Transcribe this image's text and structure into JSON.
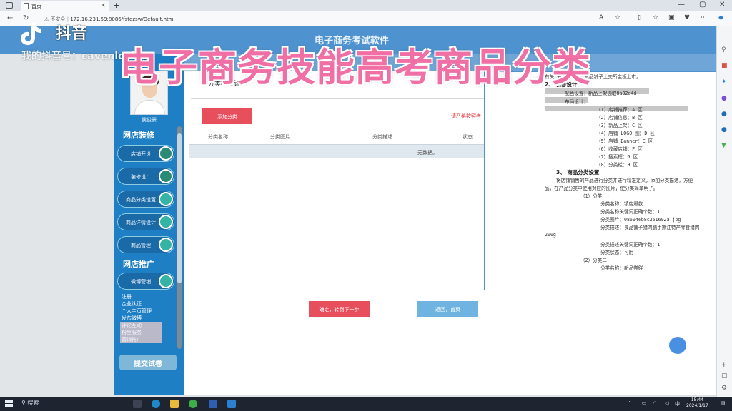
{
  "browser": {
    "tab_title": "首页",
    "tab_close": "✕",
    "new_tab": "+",
    "address_warning": "不安全",
    "url": "172.16.231.59:8086/fstdzsw/Default.html",
    "win_min": "—",
    "win_max": "▢",
    "win_close": "✕"
  },
  "page": {
    "app_title": "电子商务考试软件"
  },
  "sidebar": {
    "user_name": "侯俊豪",
    "section_shop_design": "网店装修",
    "menu": [
      "店铺开设",
      "装修设计",
      "商品分类设置",
      "商品详情设计",
      "商品管理"
    ],
    "section_promotion": "网店推广",
    "promo_item": "微博营销",
    "sub_items": [
      "注册",
      "企业认证",
      "个人主页管理",
      "发布微博",
      "评论互动",
      "粉丝服务",
      "营销推广"
    ],
    "submit_label": "提交试卷"
  },
  "content": {
    "title": "分类栏设计",
    "add_button": "添加分类",
    "note": "请严格按照考",
    "columns": [
      "分类名称",
      "分类图片",
      "分类描述",
      "状态"
    ],
    "empty_text": "无数据。",
    "next_button": "确定，转到下一步",
    "back_button": "返回，首页"
  },
  "question": {
    "lines": [
      "有关                        元           20年初，良品铺子上交所主板上市。",
      "2、 装修设计",
      "配色设置：新品上架选取8a32e4d",
      "布局设计：",
      "（1）店铺推荐：A 区",
      "（2）店铺信息：B 区",
      "（3）新品上架：C 区",
      "（4）店铺 LOGO 图：D 区",
      "（5）店铺 Banner：E 区",
      "（6）收藏店铺：F 区",
      "（7）搜索框：G 区",
      "（8）分类栏：H 区",
      "3、 商品分类设置",
      "将店铺销售的产品进行分类并进行精准定义，添加分类描述，方便",
      "品，在产品分类中使用对应的图片，使分类简单明了。",
      "（1）分类一：",
      "分类名称：镇店爆款",
      "分类名称关键词正确个数：1",
      "分类图片：08604eb8c251692a.jpg",
      "分类描述：良品铺子猪肉脯手撕江特产零食猪肉",
      "200g",
      "分类描述关键词正确个数：1",
      "分类状态：可用",
      "（2）分类二：",
      "分类名称：新品尝鲜"
    ]
  },
  "overlay": {
    "douyin_name": "抖音",
    "douyin_id": "我的抖音号：cavenloving",
    "caption": "电子商务技能高考商品分类"
  },
  "taskbar": {
    "search": "搜索",
    "time": "15:44",
    "date": "2024/1/17"
  },
  "colors": {
    "header_blue": "#4e93cf",
    "sidebar_blue": "#1f7fc5",
    "accent_red": "#e84f5c",
    "caption_pink": "#f06fa5"
  }
}
